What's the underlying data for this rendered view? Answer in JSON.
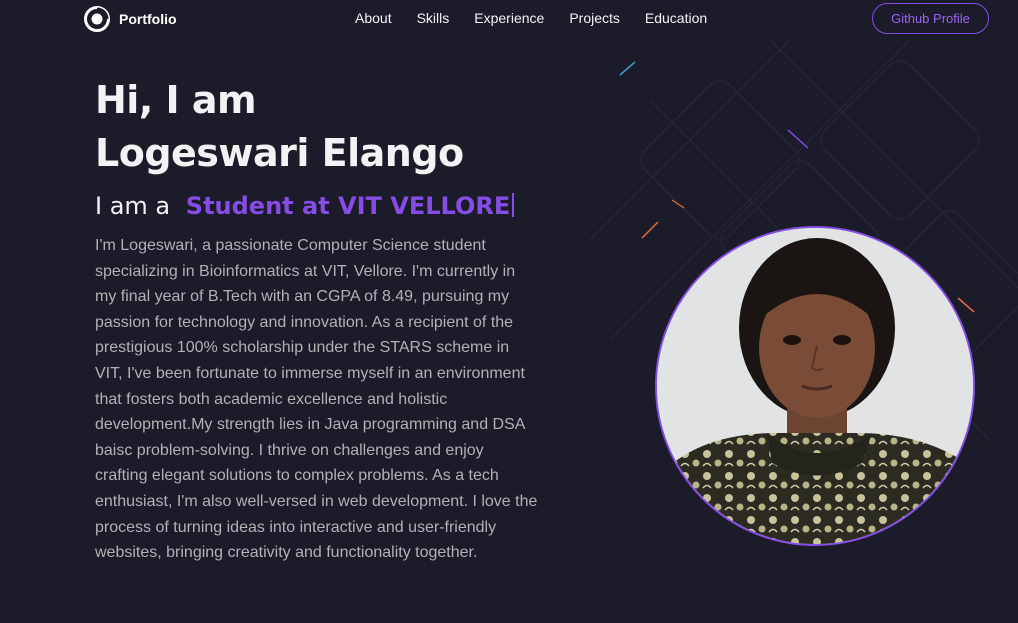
{
  "nav": {
    "logo_text": "Portfolio",
    "links": [
      "About",
      "Skills",
      "Experience",
      "Projects",
      "Education"
    ],
    "github_button": "Github Profile"
  },
  "hero": {
    "title_line1": "Hi, I am",
    "title_line2": "Logeswari Elango",
    "role_prefix": "I am a",
    "role_text": "Student at VIT VELLORE",
    "description": "I'm Logeswari, a passionate Computer Science student specializing in Bioinformatics at VIT, Vellore. I'm currently in my final year of B.Tech with an CGPA of 8.49, pursuing my passion for technology and innovation. As a recipient of the prestigious 100% scholarship under the STARS scheme in VIT, I've been fortunate to immerse myself in an environment that fosters both academic excellence and holistic development.My strength lies in Java programming and DSA baisc problem-solving. I thrive on challenges and enjoy crafting elegant solutions to complex problems. As a tech enthusiast, I'm also well-versed in web development. I love the process of turning ideas into interactive and user-friendly websites, bringing creativity and functionality together."
  },
  "icons": {
    "logo": "portfolio-logo-icon",
    "profile": "profile-photo"
  },
  "colors": {
    "background": "#1c1b29",
    "accent": "#854ce6",
    "text_primary": "#f2f3f5",
    "text_secondary": "#b1b2b3"
  }
}
